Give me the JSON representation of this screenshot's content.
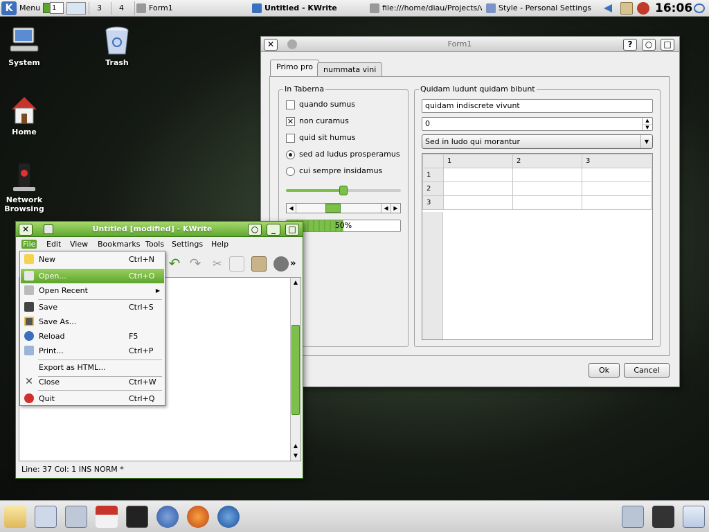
{
  "top_panel": {
    "menu_label": "Menu",
    "pager_input": "1",
    "desktops": [
      "3",
      "4"
    ],
    "tasks": [
      {
        "label": "Form1"
      },
      {
        "label": "Untitled - KWrite"
      },
      {
        "label": "file:///home/diau/Projects/wid"
      },
      {
        "label": "Style - Personal Settings"
      }
    ],
    "clock": "16:06"
  },
  "desktop_icons": [
    {
      "label": "System"
    },
    {
      "label": "Trash"
    },
    {
      "label": "Home"
    },
    {
      "label": "Network Browsing"
    }
  ],
  "form1": {
    "title": "Form1",
    "tabs": [
      "Primo pro",
      "nummata vini"
    ],
    "group_left": {
      "title": "In Taberna",
      "checkboxes": [
        {
          "label": "quando sumus",
          "checked": false
        },
        {
          "label": "non curamus",
          "checked": true
        },
        {
          "label": "quid sit humus",
          "checked": false
        }
      ],
      "radios": [
        {
          "label": "sed ad ludus prosperamus",
          "checked": true
        },
        {
          "label": "cui sempre insidamus",
          "checked": false
        }
      ],
      "slider_value": 0.5,
      "progress_text": "50%",
      "progress_value": 0.5
    },
    "group_right": {
      "title": "Quidam ludunt quidam bibunt",
      "line_edit": "quidam indiscrete vivunt",
      "spin_value": "0",
      "combo_value": "Sed in ludo qui morantur",
      "table_col_headers": [
        "1",
        "2",
        "3"
      ],
      "table_row_headers": [
        "1",
        "2",
        "3"
      ]
    },
    "ok_label": "Ok",
    "cancel_label": "Cancel"
  },
  "kwrite": {
    "title": "Untitled [modified] - KWrite",
    "menus": [
      "File",
      "Edit",
      "View",
      "Bookmarks",
      "Tools",
      "Settings",
      "Help"
    ],
    "file_menu": [
      {
        "label": "New",
        "shortcut": "Ctrl+N"
      },
      {
        "label": "Open...",
        "shortcut": "Ctrl+O"
      },
      {
        "label": "Open Recent",
        "shortcut": ""
      },
      {
        "label": "Save",
        "shortcut": "Ctrl+S"
      },
      {
        "label": "Save As...",
        "shortcut": ""
      },
      {
        "label": "Reload",
        "shortcut": "F5"
      },
      {
        "label": "Print...",
        "shortcut": "Ctrl+P"
      },
      {
        "label": "Export as HTML...",
        "shortcut": ""
      },
      {
        "label": "Close",
        "shortcut": "Ctrl+W"
      },
      {
        "label": "Quit",
        "shortcut": "Ctrl+Q"
      }
    ],
    "status": "Line: 37 Col: 1  INS  NORM  *"
  },
  "colors": {
    "accent_green": "#5da52c",
    "kde_blue": "#3d6fbf"
  }
}
